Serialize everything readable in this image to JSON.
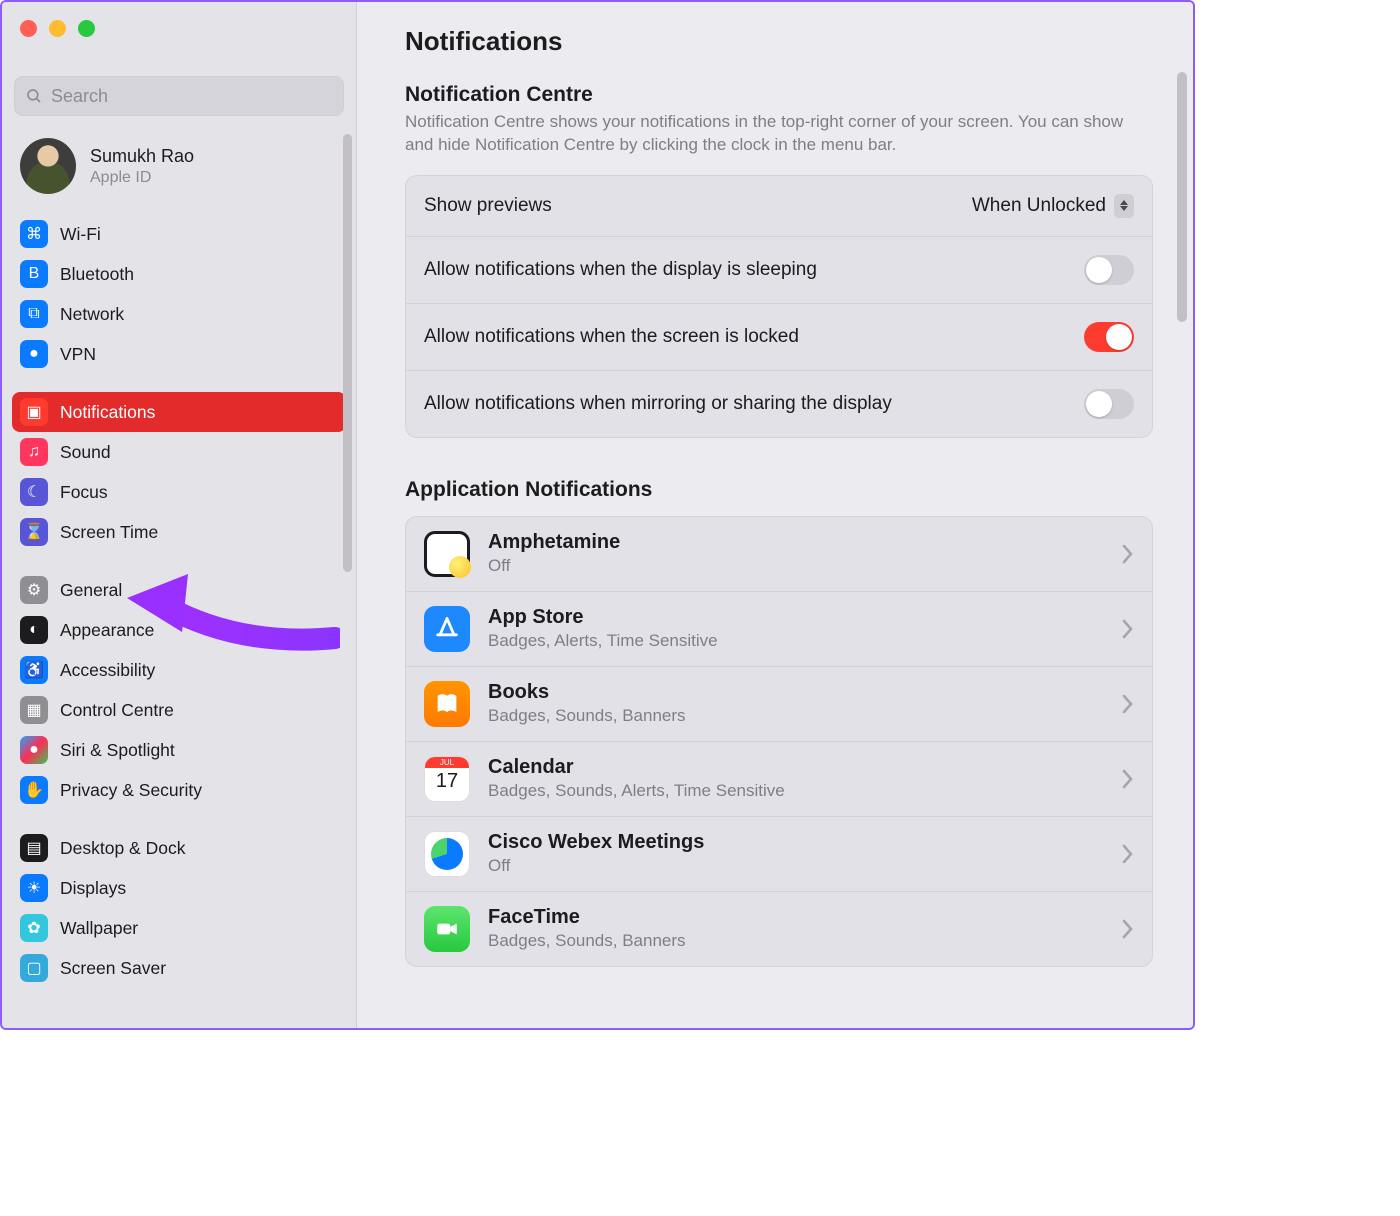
{
  "header": {
    "title": "Notifications"
  },
  "search": {
    "placeholder": "Search"
  },
  "account": {
    "name": "Sumukh Rao",
    "sub": "Apple ID"
  },
  "sidebar": {
    "groups": [
      {
        "items": [
          {
            "label": "Wi-Fi",
            "icon": "wifi"
          },
          {
            "label": "Bluetooth",
            "icon": "bt"
          },
          {
            "label": "Network",
            "icon": "net"
          },
          {
            "label": "VPN",
            "icon": "vpn"
          }
        ]
      },
      {
        "items": [
          {
            "label": "Notifications",
            "icon": "notif",
            "selected": true
          },
          {
            "label": "Sound",
            "icon": "sound"
          },
          {
            "label": "Focus",
            "icon": "focus"
          },
          {
            "label": "Screen Time",
            "icon": "screentime"
          }
        ]
      },
      {
        "items": [
          {
            "label": "General",
            "icon": "general"
          },
          {
            "label": "Appearance",
            "icon": "appearance"
          },
          {
            "label": "Accessibility",
            "icon": "access"
          },
          {
            "label": "Control Centre",
            "icon": "control"
          },
          {
            "label": "Siri & Spotlight",
            "icon": "siri"
          },
          {
            "label": "Privacy & Security",
            "icon": "privacy"
          }
        ]
      },
      {
        "items": [
          {
            "label": "Desktop & Dock",
            "icon": "dock"
          },
          {
            "label": "Displays",
            "icon": "displays"
          },
          {
            "label": "Wallpaper",
            "icon": "wallpaper"
          },
          {
            "label": "Screen Saver",
            "icon": "saver"
          }
        ]
      }
    ]
  },
  "centre": {
    "title": "Notification Centre",
    "desc": "Notification Centre shows your notifications in the top-right corner of your screen. You can show and hide Notification Centre by clicking the clock in the menu bar."
  },
  "previews": {
    "label": "Show previews",
    "value": "When Unlocked"
  },
  "switches": [
    {
      "label": "Allow notifications when the display is sleeping",
      "on": false
    },
    {
      "label": "Allow notifications when the screen is locked",
      "on": true
    },
    {
      "label": "Allow notifications when mirroring or sharing the display",
      "on": false
    }
  ],
  "appsTitle": "Application Notifications",
  "apps": [
    {
      "name": "Amphetamine",
      "detail": "Off",
      "icon": "amp"
    },
    {
      "name": "App Store",
      "detail": "Badges, Alerts, Time Sensitive",
      "icon": "appstore"
    },
    {
      "name": "Books",
      "detail": "Badges, Sounds, Banners",
      "icon": "books"
    },
    {
      "name": "Calendar",
      "detail": "Badges, Sounds, Alerts, Time Sensitive",
      "icon": "cal"
    },
    {
      "name": "Cisco Webex Meetings",
      "detail": "Off",
      "icon": "webex"
    },
    {
      "name": "FaceTime",
      "detail": "Badges, Sounds, Banners",
      "icon": "facetime"
    }
  ],
  "calendar": {
    "month": "JUL",
    "day": "17"
  }
}
